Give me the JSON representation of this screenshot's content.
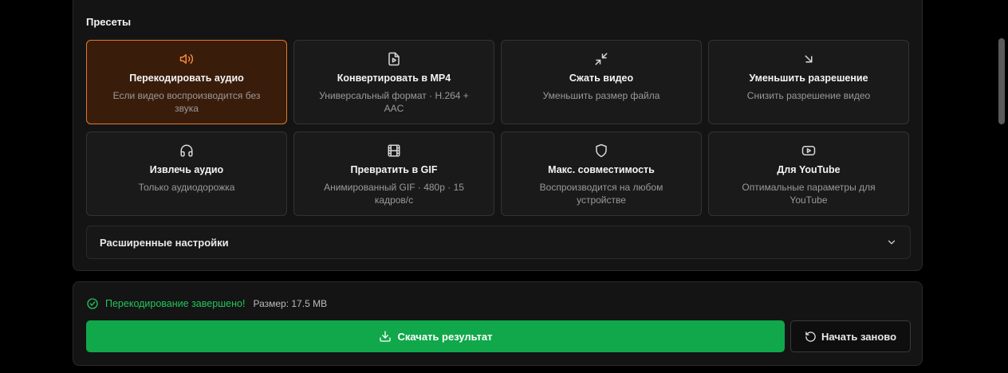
{
  "presets": {
    "title": "Пресеты",
    "cards": [
      {
        "icon": "speaker-icon",
        "title": "Перекодировать аудио",
        "desc": "Если видео воспроизводится без звука",
        "active": true
      },
      {
        "icon": "file-video-icon",
        "title": "Конвертировать в MP4",
        "desc": "Универсальный формат · H.264 + AAC",
        "active": false
      },
      {
        "icon": "compress-icon",
        "title": "Сжать видео",
        "desc": "Уменьшить размер файла",
        "active": false
      },
      {
        "icon": "arrow-down-right-icon",
        "title": "Уменьшить разрешение",
        "desc": "Снизить разрешение видео",
        "active": false
      },
      {
        "icon": "headphones-icon",
        "title": "Извлечь аудио",
        "desc": "Только аудиодорожка",
        "active": false
      },
      {
        "icon": "film-icon",
        "title": "Превратить в GIF",
        "desc": "Анимированный GIF · 480p · 15 кадров/с",
        "active": false
      },
      {
        "icon": "shield-icon",
        "title": "Макс. совместимость",
        "desc": "Воспроизводится на любом устройстве",
        "active": false
      },
      {
        "icon": "youtube-icon",
        "title": "Для YouTube",
        "desc": "Оптимальные параметры для YouTube",
        "active": false
      }
    ]
  },
  "advanced": {
    "label": "Расширенные настройки",
    "icon": "chevron-down-icon"
  },
  "status": {
    "icon": "check-circle-icon",
    "text": "Перекодирование завершено!",
    "size": "Размер: 17.5 MB"
  },
  "actions": {
    "download_label": "Скачать результат",
    "download_icon": "download-icon",
    "restart_label": "Начать заново",
    "restart_icon": "rotate-ccw-icon"
  },
  "colors": {
    "accent_orange": "#e07a2c",
    "success_green": "#22c55e",
    "download_button": "#10a84a"
  }
}
